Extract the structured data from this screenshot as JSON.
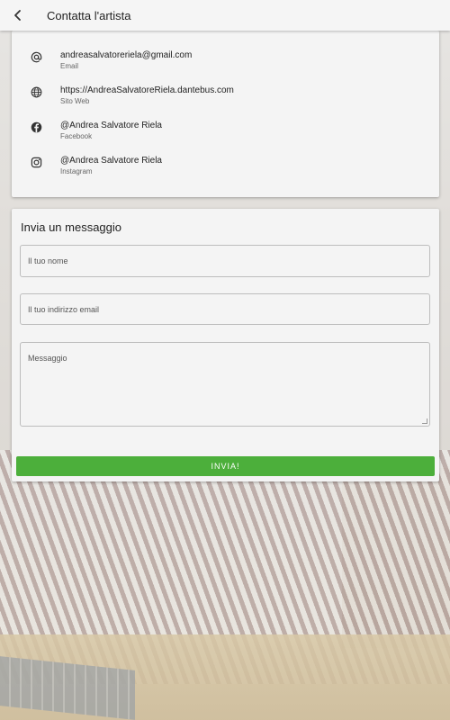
{
  "appbar": {
    "title": "Contatta l'artista",
    "back_icon": "chevron-left-icon"
  },
  "contacts": [
    {
      "icon": "at-icon",
      "value": "andreasalvatoreriela@gmail.com",
      "label": "Email"
    },
    {
      "icon": "globe-icon",
      "value": "https://AndreaSalvatoreRiela.dantebus.com",
      "label": "Sito Web"
    },
    {
      "icon": "facebook-icon",
      "value": "@Andrea Salvatore Riela",
      "label": "Facebook"
    },
    {
      "icon": "instagram-icon",
      "value": "@Andrea Salvatore Riela",
      "label": "Instagram"
    }
  ],
  "form": {
    "title": "Invia un messaggio",
    "name_placeholder": "Il tuo nome",
    "email_placeholder": "Il tuo indirizzo email",
    "message_placeholder": "Messaggio",
    "send_label": "INVIA!"
  },
  "colors": {
    "accent": "#4caf3b",
    "card": "#f4f4f4",
    "appbar": "#f5f5f5"
  }
}
